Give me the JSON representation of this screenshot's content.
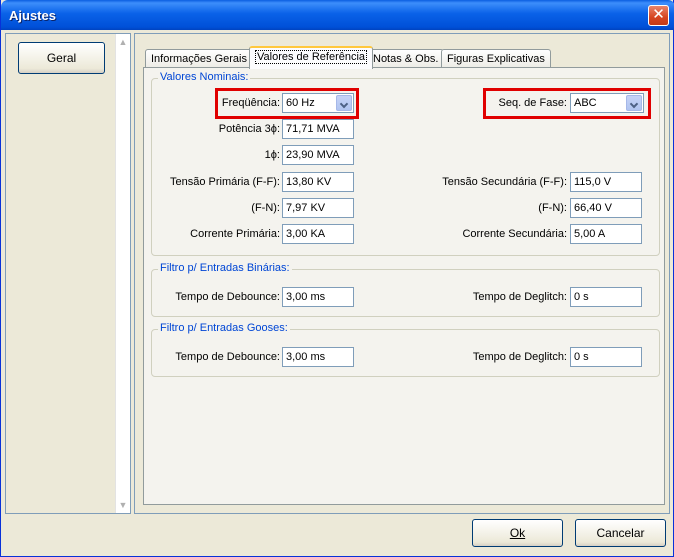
{
  "window": {
    "title": "Ajustes",
    "close_glyph": "✕"
  },
  "sidebar": {
    "items": [
      {
        "label": "Geral"
      }
    ]
  },
  "tabs": [
    {
      "label": "Informações Gerais",
      "active": false
    },
    {
      "label": "Valores de Referência",
      "active": true
    },
    {
      "label": "Notas & Obs.",
      "active": false
    },
    {
      "label": "Figuras Explicativas",
      "active": false
    }
  ],
  "nominal": {
    "legend": "Valores Nominais:",
    "frequencia": {
      "label": "Freqüência:",
      "value": "60 Hz"
    },
    "seq_fase": {
      "label": "Seq. de Fase:",
      "value": "ABC"
    },
    "potencia_3f": {
      "label": "Potência 3ϕ:",
      "value": "71,71 MVA"
    },
    "potencia_1f": {
      "label": "1ϕ:",
      "value": "23,90 MVA"
    },
    "tensao_primaria_ff": {
      "label": "Tensão Primária (F-F):",
      "value": "13,80 KV"
    },
    "tensao_primaria_fn": {
      "label": "(F-N):",
      "value": "7,97 KV"
    },
    "corrente_primaria": {
      "label": "Corrente Primária:",
      "value": "3,00 KA"
    },
    "tensao_secundaria_ff": {
      "label": "Tensão Secundária (F-F):",
      "value": "115,0 V"
    },
    "tensao_secundaria_fn": {
      "label": "(F-N):",
      "value": "66,40 V"
    },
    "corrente_secundaria": {
      "label": "Corrente Secundária:",
      "value": "5,00 A"
    }
  },
  "binarias": {
    "legend": "Filtro p/ Entradas Binárias:",
    "debounce": {
      "label": "Tempo de Debounce:",
      "value": "3,00 ms"
    },
    "deglitch": {
      "label": "Tempo de Deglitch:",
      "value": "0 s"
    }
  },
  "gooses": {
    "legend": "Filtro p/ Entradas Gooses:",
    "debounce": {
      "label": "Tempo de Debounce:",
      "value": "3,00 ms"
    },
    "deglitch": {
      "label": "Tempo de Deglitch:",
      "value": "0 s"
    }
  },
  "buttons": {
    "ok": "Ok",
    "cancel": "Cancelar"
  },
  "colors": {
    "title_bar": "#0a62e8",
    "legend_text": "#0046d5",
    "highlight_border": "#e00000",
    "window_bg": "#ece9d8"
  }
}
